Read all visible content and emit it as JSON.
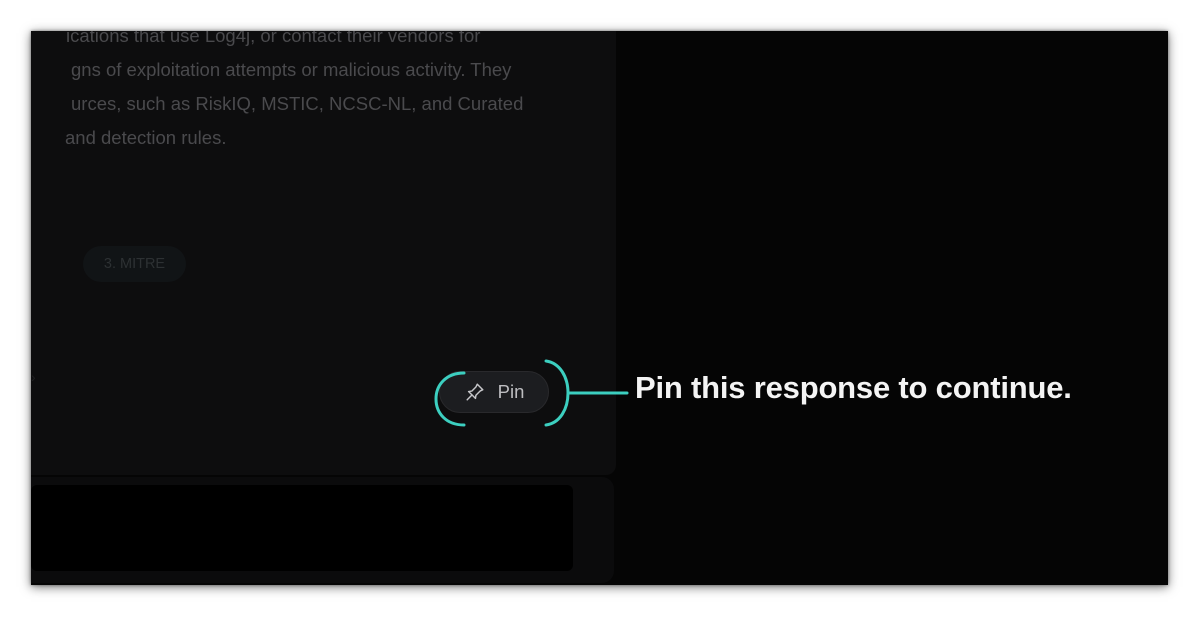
{
  "response": {
    "lines": [
      "ications that use Log4j, or contact their vendors for",
      "gns of exploitation attempts or malicious activity. They",
      "urces, such as RiskIQ, MSTIC, NCSC-NL, and Curated",
      "and detection rules."
    ],
    "reference_chip": "3. MITRE"
  },
  "pin_button": {
    "label": "Pin",
    "icon": "pin-icon"
  },
  "callout": {
    "text": "Pin this response to continue.",
    "color": "#3ccfc0"
  },
  "prompt_input": {
    "value": ""
  }
}
